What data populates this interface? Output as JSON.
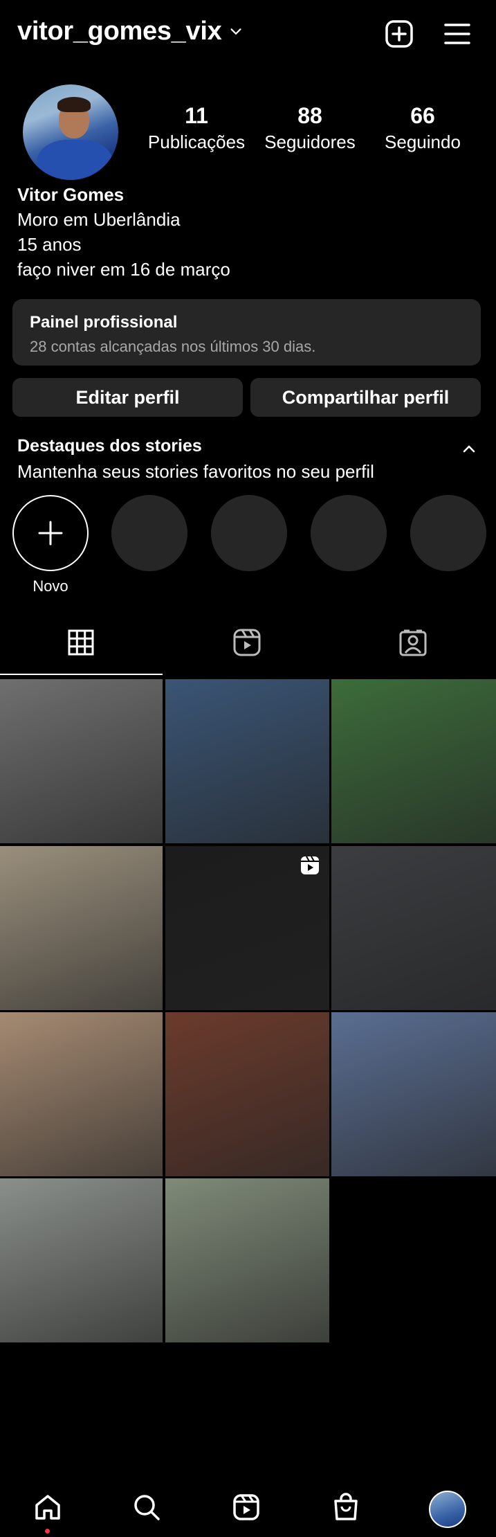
{
  "header": {
    "username": "vitor_gomes_vix"
  },
  "profile": {
    "stats": [
      {
        "value": "11",
        "label": "Publicações"
      },
      {
        "value": "88",
        "label": "Seguidores"
      },
      {
        "value": "66",
        "label": "Seguindo"
      }
    ],
    "name": "Vitor Gomes",
    "bio": [
      "Moro em Uberlândia",
      "15 anos",
      "faço niver em 16 de março"
    ]
  },
  "panel": {
    "title": "Painel profissional",
    "subtitle": "28 contas alcançadas nos últimos 30 dias."
  },
  "buttons": {
    "edit": "Editar perfil",
    "share": "Compartilhar perfil"
  },
  "highlights": {
    "title": "Destaques dos stories",
    "subtitle": "Mantenha seus stories favoritos no seu perfil",
    "new_label": "Novo"
  },
  "tabs": [
    "grid-icon",
    "reels-icon",
    "tagged-icon"
  ],
  "grid": {
    "colors": [
      "#6f6f6f",
      "#3a5575",
      "#3c6c3a",
      "#9a8f7c",
      "#1c1c1c",
      "#3b3d40",
      "#a58a72",
      "#6b3b2c",
      "#5a6e92",
      "#8a8f8a",
      "#7f8a78"
    ]
  },
  "bottom_nav": [
    "home-icon",
    "search-icon",
    "reels-icon",
    "shop-icon",
    "profile-avatar"
  ]
}
